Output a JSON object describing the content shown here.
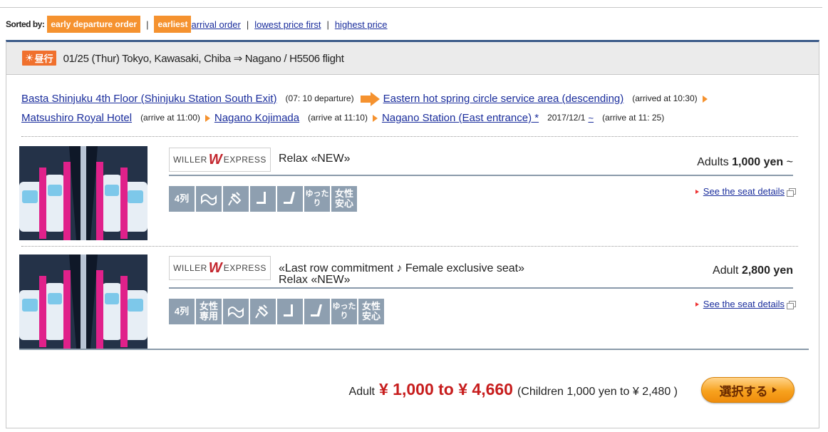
{
  "sort": {
    "label": "Sorted by:",
    "active": [
      "early departure order",
      "earliest"
    ],
    "separator": "|",
    "links": [
      "arrival order",
      "lowest price first",
      "highest price"
    ]
  },
  "trip": {
    "badge": "昼行",
    "title": "01/25 (Thur) Tokyo, Kawasaki, Chiba ⇒ Nagano / H5506 flight"
  },
  "route": {
    "stops": [
      {
        "name": "Basta Shinjuku 4th Floor (Shinjuku Station South Exit)",
        "time": "(07: 10 departure)"
      },
      {
        "name": "Eastern hot spring circle service area (descending)",
        "time": "(arrived at 10:30)"
      },
      {
        "name": "Matsushiro Royal Hotel",
        "time": "(arrive at 11:00)"
      },
      {
        "name": "Nagano Kojimada",
        "time": "(arrive at 11:10)"
      },
      {
        "name": "Nagano Station (East entrance) *",
        "date": "2017/12/1",
        "tilde": "~",
        "time": "(arrive at 11: 25)"
      }
    ]
  },
  "plans": [
    {
      "brand": {
        "left": "WILLER",
        "mark": "W",
        "right": "EXPRESS"
      },
      "name": "Relax «NEW»",
      "price_prefix": "Adults",
      "price": "1,000 yen",
      "price_suffix": "~",
      "seat_details": "See the seat details",
      "icons": [
        "4列",
        "wave",
        "plug",
        "seat",
        "recline",
        "ゆったり",
        "女性安心"
      ]
    },
    {
      "brand": {
        "left": "WILLER",
        "mark": "W",
        "right": "EXPRESS"
      },
      "name": "«Last row commitment ♪ Female exclusive seat» Relax «NEW»",
      "price_prefix": "Adult",
      "price": "2,800 yen",
      "price_suffix": "",
      "seat_details": "See the seat details",
      "icons": [
        "4列",
        "女性専用",
        "wave",
        "plug",
        "seat",
        "recline",
        "ゆったり",
        "女性安心"
      ]
    }
  ],
  "summary": {
    "adult_label": "Adult",
    "range": "¥ 1,000 to ¥ 4,660",
    "children": "(Children 1,000 yen to ¥ 2,480 )",
    "button": "選択する"
  },
  "colors": {
    "accent": "#f5922f",
    "link": "#1a2d9c",
    "price_red": "#c71d1d",
    "icon_bg": "#8e9fb0",
    "header_border": "#3b5a88"
  }
}
